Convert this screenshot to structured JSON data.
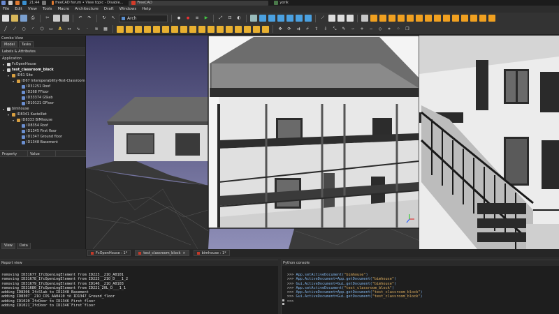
{
  "taskbar": {
    "clock": "21:44",
    "tasks": [
      {
        "label": "freeCAD forum • View topic - Disable...",
        "active": false
      },
      {
        "label": "FreeCAD",
        "active": true
      },
      {
        "label": "yorik",
        "active": false
      }
    ]
  },
  "menubar": {
    "items": [
      "File",
      "Edit",
      "View",
      "Tools",
      "Macro",
      "Architecture",
      "Draft",
      "Windows",
      "Help"
    ]
  },
  "toolbar": {
    "workbench": "Arch"
  },
  "combo": {
    "title": "Combo View",
    "tabs": [
      "Model",
      "Tasks"
    ],
    "header": "Labels & Attributes",
    "section": "Application",
    "tree": [
      {
        "label": "FcOpenHouse",
        "level": 0,
        "bold": false,
        "icon": "doc-icon"
      },
      {
        "label": "test_classroom_block",
        "level": 0,
        "bold": true,
        "icon": "doc-icon"
      },
      {
        "label": "ID61 Site",
        "level": 1,
        "bold": false,
        "icon": "site-icon"
      },
      {
        "label": "ID67 Interoperability-Test-Classroom",
        "level": 2,
        "bold": false,
        "icon": "building-icon"
      },
      {
        "label": "ID31251 Roof",
        "level": 3,
        "bold": false,
        "icon": "floor-icon"
      },
      {
        "label": "ID268 FFloor",
        "level": 3,
        "bold": false,
        "icon": "floor-icon"
      },
      {
        "label": "ID33374 GSlab",
        "level": 3,
        "bold": false,
        "icon": "floor-icon"
      },
      {
        "label": "ID10121 GFloor",
        "level": 3,
        "bold": false,
        "icon": "floor-icon"
      },
      {
        "label": "bimhouse",
        "level": 0,
        "bold": false,
        "icon": "doc-icon"
      },
      {
        "label": "ID8341 Kastelllet",
        "level": 1,
        "bold": false,
        "icon": "site-icon"
      },
      {
        "label": "ID8333 BIMhouse",
        "level": 2,
        "bold": false,
        "icon": "building-icon"
      },
      {
        "label": "ID8354 Roof",
        "level": 3,
        "bold": false,
        "icon": "floor-icon"
      },
      {
        "label": "ID1345 First floor",
        "level": 3,
        "bold": false,
        "icon": "floor-icon"
      },
      {
        "label": "ID1347 Ground floor",
        "level": 3,
        "bold": false,
        "icon": "floor-icon"
      },
      {
        "label": "ID1348 Basement",
        "level": 3,
        "bold": false,
        "icon": "floor-icon"
      }
    ],
    "property_cols": [
      "Property",
      "Value"
    ],
    "bottom_tabs": [
      "View",
      "Data"
    ]
  },
  "doc_tabs": [
    {
      "label": "FcOpenHouse : 1*",
      "active": false
    },
    {
      "label": "test_classroom_block",
      "active": true
    },
    {
      "label": "bimhouse : 1*",
      "active": false
    }
  ],
  "report": {
    "title": "Report view",
    "lines": [
      "removing ID31677_IfcOpeningElement from ID223__21O_A0101",
      "removing ID31678_IfcOpeningElement from ID223__21O_D___1_2",
      "removing ID31679_IfcOpeningElement from ID146__21O_A0103",
      "removing ID31680_IfcOpeningElement from ID221_20L_D___1_1",
      "adding ID8306_IfcSlab to ID1348_Basement",
      "adding ID8307__21O_COS_AA0410 to ID1347_Ground_floor",
      "adding ID1020_IfcDoor to ID1346_First_floor",
      "adding ID1021_IfcDoor to ID1346 First floor"
    ]
  },
  "python": {
    "title": "Python console",
    "lines": [
      {
        "prompt": ">>> ",
        "code": "App.setActiveDocument(",
        "str": "\"bimhouse\"",
        "end": ")"
      },
      {
        "prompt": ">>> ",
        "code": "App.ActiveDocument=App.getDocument(",
        "str": "\"bimhouse\"",
        "end": ")"
      },
      {
        "prompt": ">>> ",
        "code": "Gui.ActiveDocument=Gui.getDocument(",
        "str": "\"bimhouse\"",
        "end": ")"
      },
      {
        "prompt": ">>> ",
        "code": "App.setActiveDocument(",
        "str": "\"test_classroom_block\"",
        "end": ")"
      },
      {
        "prompt": ">>> ",
        "code": "App.ActiveDocument=App.getDocument(",
        "str": "\"test_classroom_block\"",
        "end": ")"
      },
      {
        "prompt": ">>> ",
        "code": "Gui.ActiveDocument=Gui.getDocument(",
        "str": "\"test_classroom_block\"",
        "end": ")"
      },
      {
        "prompt": ">>> ",
        "code": "",
        "str": "",
        "end": ""
      }
    ]
  },
  "colors": {
    "view_background": "#47466f",
    "accent_orange": "#f0a020",
    "console_code": "#7fb2e8",
    "console_string": "#e0b060"
  }
}
